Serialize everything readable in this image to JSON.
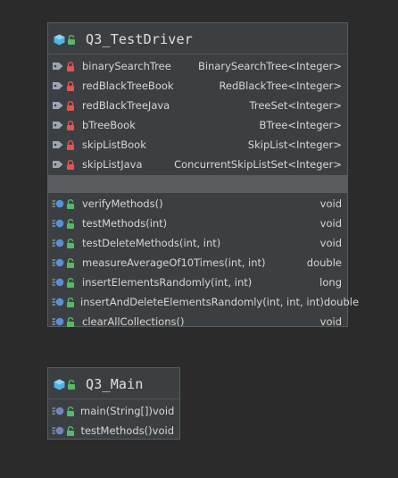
{
  "diagram": {
    "classes": [
      {
        "name": "Q3_TestDriver",
        "fields": [
          {
            "name": "binarySearchTree",
            "type": "BinarySearchTree<Integer>",
            "visibility": "private"
          },
          {
            "name": "redBlackTreeBook",
            "type": "RedBlackTree<Integer>",
            "visibility": "private"
          },
          {
            "name": "redBlackTreeJava",
            "type": "TreeSet<Integer>",
            "visibility": "private"
          },
          {
            "name": "bTreeBook",
            "type": "BTree<Integer>",
            "visibility": "private"
          },
          {
            "name": "skipListBook",
            "type": "SkipList<Integer>",
            "visibility": "private"
          },
          {
            "name": "skipListJava",
            "type": "ConcurrentSkipListSet<Integer>",
            "visibility": "private"
          }
        ],
        "methods": [
          {
            "name": "verifyMethods()",
            "type": "void",
            "visibility": "public"
          },
          {
            "name": "testMethods(int)",
            "type": "void",
            "visibility": "public"
          },
          {
            "name": "testDeleteMethods(int, int)",
            "type": "void",
            "visibility": "public"
          },
          {
            "name": "measureAverageOf10Times(int, int)",
            "type": "double",
            "visibility": "public"
          },
          {
            "name": "insertElementsRandomly(int, int)",
            "type": "long",
            "visibility": "public"
          },
          {
            "name": "insertAndDeleteElementsRandomly(int, int, int)",
            "type": "double",
            "visibility": "public"
          },
          {
            "name": "clearAllCollections()",
            "type": "void",
            "visibility": "public"
          }
        ]
      },
      {
        "name": "Q3_Main",
        "fields": [],
        "methods": [
          {
            "name": "main(String[])",
            "type": "void",
            "visibility": "public",
            "static": true
          },
          {
            "name": "testMethods()",
            "type": "void",
            "visibility": "public",
            "static": true
          }
        ]
      }
    ]
  },
  "colors": {
    "background": "#2b2b2b",
    "box_fill": "#3c3f41",
    "class_icon": "#4fb3e8",
    "lock_public": "#58b86a",
    "lock_private": "#e05555",
    "field_tag": "#9aa7b3",
    "method_ball": "#5a8fd6"
  },
  "icons": {
    "class": "class-icon",
    "field": "field-tag-icon",
    "method": "method-icon",
    "public": "lock-open-icon",
    "private": "lock-closed-icon"
  }
}
